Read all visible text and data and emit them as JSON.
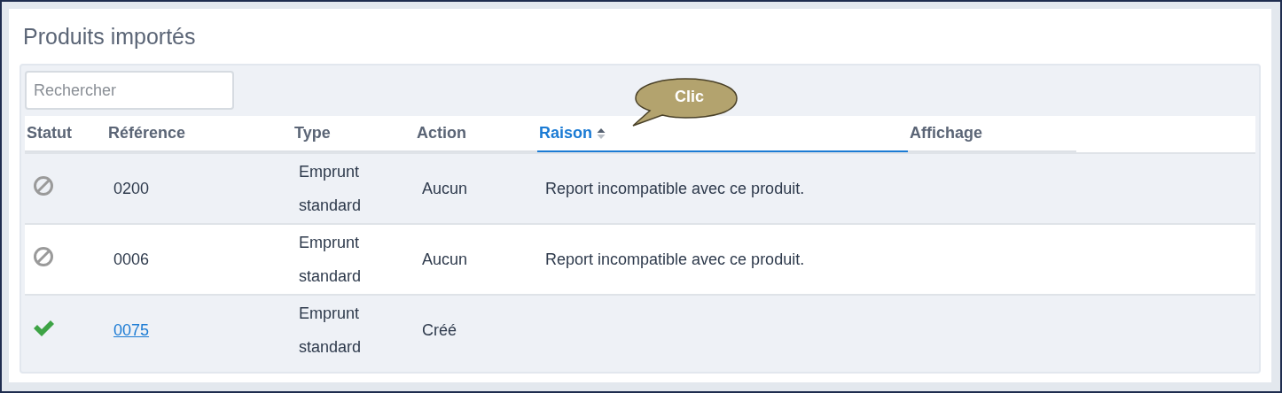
{
  "title": "Produits importés",
  "search": {
    "placeholder": "Rechercher"
  },
  "columns": [
    {
      "label": "Statut",
      "sorted": false
    },
    {
      "label": "Référence",
      "sorted": false
    },
    {
      "label": "Type",
      "sorted": false
    },
    {
      "label": "Action",
      "sorted": false
    },
    {
      "label": "Raison",
      "sorted": true
    },
    {
      "label": "Affichage",
      "sorted": false
    }
  ],
  "callout": {
    "text": "Clic"
  },
  "rows": [
    {
      "kind": "blocked",
      "reference": "0200",
      "link": false,
      "type": "Emprunt standard",
      "action": "Aucun",
      "reason": "Report incompatible avec ce produit."
    },
    {
      "kind": "blocked",
      "reference": "0006",
      "link": false,
      "type": "Emprunt standard",
      "action": "Aucun",
      "reason": "Report incompatible avec ce produit."
    },
    {
      "kind": "ok",
      "reference": "0075",
      "link": true,
      "type": "Emprunt standard",
      "action": "Créé"
    }
  ]
}
